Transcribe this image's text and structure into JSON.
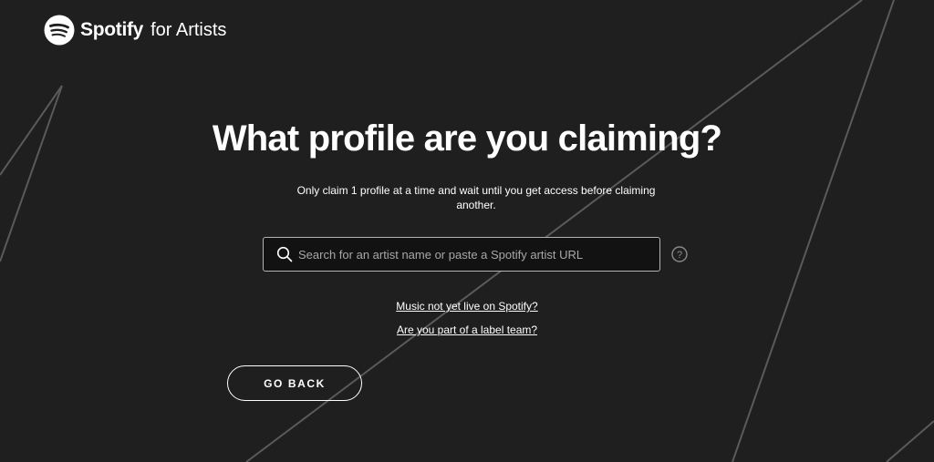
{
  "brand": {
    "logo_text": "Spotify",
    "logo_suffix": "for Artists",
    "logo_icon": "spotify-logo-icon"
  },
  "main": {
    "title": "What profile are you claiming?",
    "subtitle": "Only claim 1 profile at a time and wait until you get access before claiming another.",
    "search": {
      "placeholder": "Search for an artist name or paste a Spotify artist URL",
      "value": "",
      "icon": "search-icon"
    },
    "help_icon": "question-mark-icon",
    "links": {
      "music_not_live": "Music not yet live on Spotify?",
      "label_team": "Are you part of a label team?"
    },
    "back_button_label": "GO BACK"
  },
  "colors": {
    "background": "#1f1f1f",
    "text": "#ffffff",
    "input_background": "#121212",
    "input_border": "#b3b3b3",
    "placeholder": "#a7a7a7",
    "background_lines": "#5a5a5a"
  }
}
